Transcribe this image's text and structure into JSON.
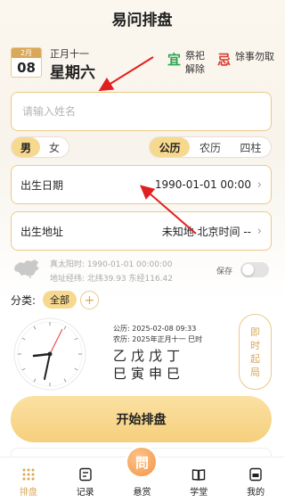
{
  "header": {
    "title": "易问排盘"
  },
  "date_card": {
    "month": "2月",
    "day": "08",
    "lunar": "正月十一",
    "weekday": "星期六",
    "yi_char": "宜",
    "yi_items": "祭祀 解除",
    "ji_char": "忌",
    "ji_items": "馀事勿取"
  },
  "name_field": {
    "placeholder": "请输入姓名",
    "value": ""
  },
  "gender": {
    "options": [
      "男",
      "女"
    ],
    "selected": "男"
  },
  "calendar_type": {
    "options": [
      "公历",
      "农历",
      "四柱"
    ],
    "selected": "公历"
  },
  "birth_date": {
    "label": "出生日期",
    "value": "1990-01-01 00:00"
  },
  "birth_place": {
    "label": "出生地址",
    "value": "未知地 北京时间 --"
  },
  "solar_time": "真太阳时: 1990-01-01 00:00:00",
  "location_coords": "地址经纬: 北纬39.93 东经116.42",
  "save": {
    "label": "保存",
    "enabled": false
  },
  "category": {
    "label": "分类:",
    "selected": "全部",
    "add": "+"
  },
  "current": {
    "gregorian": "公历: 2025-02-08 09:33",
    "lunar": "农历: 2025年正月十一 巳时",
    "stems": "乙戊戊丁",
    "branches": "巳寅申巳"
  },
  "instant_button": {
    "chars": [
      "即",
      "时",
      "起",
      "局"
    ]
  },
  "start_button": {
    "label": "开始排盘"
  },
  "tabs": [
    {
      "label": "排盘",
      "icon": "grid-dots-icon",
      "active": true
    },
    {
      "label": "记录",
      "icon": "record-icon",
      "active": false
    },
    {
      "label": "悬赏",
      "icon": "reward-bubble-icon",
      "badge": "問",
      "active": false
    },
    {
      "label": "学堂",
      "icon": "book-icon",
      "active": false
    },
    {
      "label": "我的",
      "icon": "profile-card-icon",
      "active": false
    }
  ],
  "colors": {
    "accent": "#d9a85a",
    "highlight": "#f7d88f",
    "border": "#ecc98a",
    "yi": "#2aa54d",
    "ji": "#d93a2e",
    "arrow": "#e02020"
  }
}
